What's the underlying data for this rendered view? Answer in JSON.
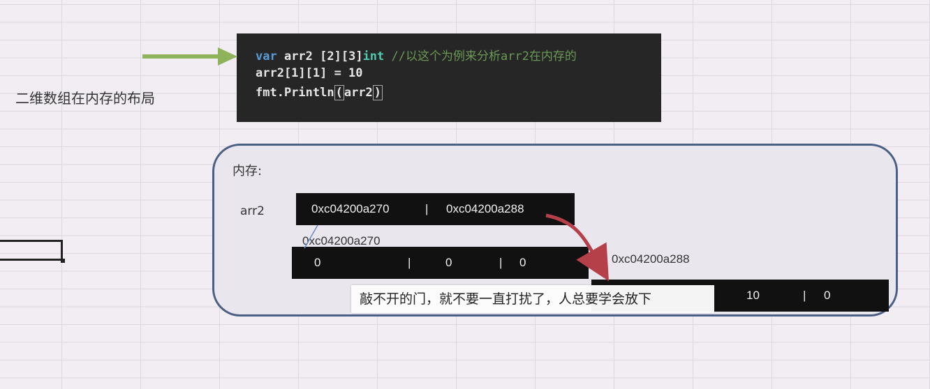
{
  "side_title": "二维数组在内存的布局",
  "code": {
    "line1": {
      "kw": "var",
      "name": " arr2 ",
      "dims": "[2][3]",
      "type": "int",
      " comment": "",
      "comment": " //以这个为例来分析arr2在内存的"
    },
    "line2": "arr2[1][1] = 10",
    "line3_prefix": "fmt.Println",
    "line3_open": "(",
    "line3_arg": "arr2",
    "line3_close": ")"
  },
  "memory": {
    "label": "内存:",
    "var_name": "arr2",
    "pointer_row": {
      "first": "0xc04200a270",
      "sep": "|",
      "second": "0xc04200a288"
    },
    "row0": {
      "address": "0xc04200a270",
      "values": [
        "0",
        "0",
        "0"
      ],
      "sep": "|"
    },
    "row1": {
      "address": "0xc04200a288",
      "values": [
        "10",
        "0"
      ],
      "sep": "|"
    }
  },
  "subtitle": "敲不开的门，就不要一直打扰了，人总要学会放下",
  "colors": {
    "arrow_green": "#8fb35a",
    "arrow_red": "#b5404a",
    "panel_border": "#4a5f84",
    "pointer_line": "#6a8cc8"
  }
}
